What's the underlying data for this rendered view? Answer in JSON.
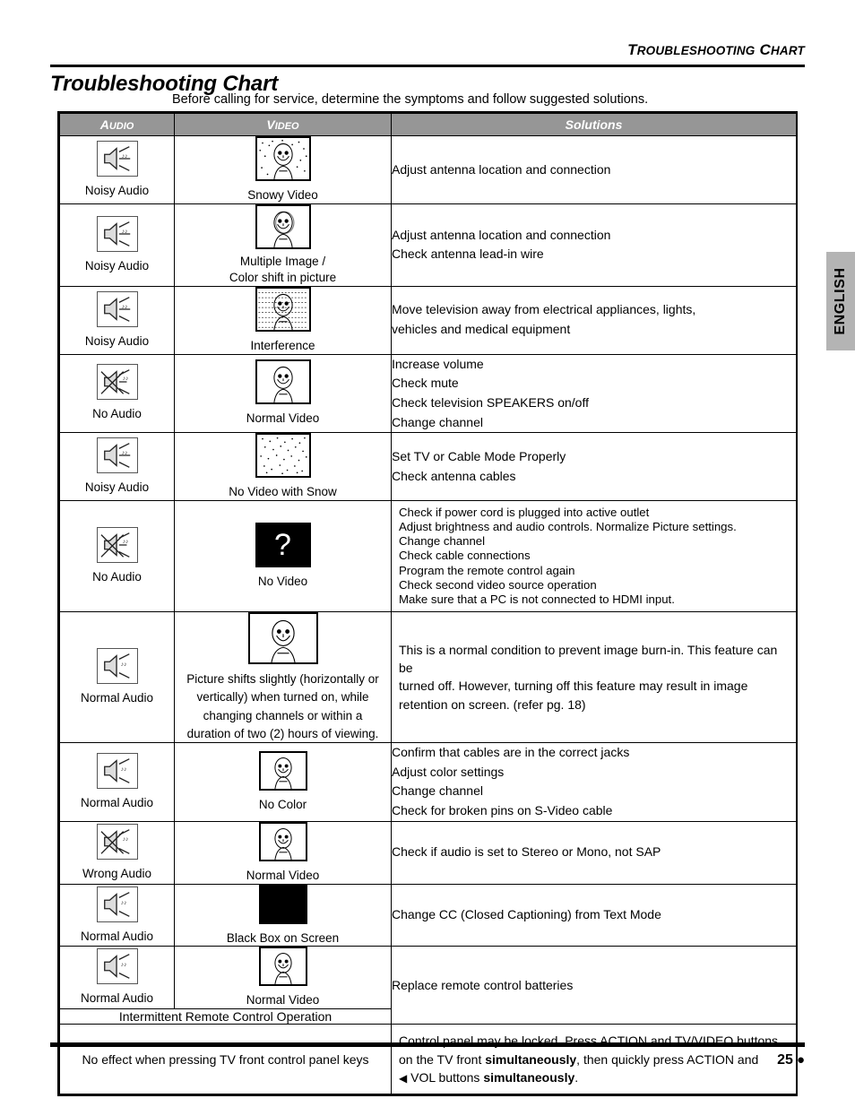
{
  "running_head": {
    "word1_cap": "T",
    "word1_rest": "ROUBLESHOOTING",
    "word2_cap": "C",
    "word2_rest": "HART"
  },
  "title": "Troubleshooting Chart",
  "subtitle": "Before calling for service, determine the symptoms and follow suggested solutions.",
  "language_tab": "ENGLISH",
  "footer": {
    "page_number": "25",
    "dot": "●"
  },
  "table": {
    "headers": {
      "audio_cap": "A",
      "audio_rest": "UDIO",
      "video_cap": "V",
      "video_rest": "IDEO",
      "solutions": "Solutions"
    },
    "rows": [
      {
        "audio_icon": "speaker-noisy-icon",
        "audio_label": "Noisy Audio",
        "video_icon": "tv-snowy-icon",
        "video_label": "Snowy Video",
        "solutions": [
          "Adjust antenna location and connection"
        ]
      },
      {
        "audio_icon": "speaker-noisy-icon",
        "audio_label": "Noisy Audio",
        "video_icon": "tv-multiple-image-icon",
        "video_label": "Multiple Image /\nColor shift in picture",
        "video_label_line1": "Multiple Image /",
        "video_label_line2": "Color shift in picture",
        "solutions": [
          "Adjust antenna location and connection",
          "Check antenna lead-in wire"
        ]
      },
      {
        "audio_icon": "speaker-noisy-icon",
        "audio_label": "Noisy Audio",
        "video_icon": "tv-interference-icon",
        "video_label": "Interference",
        "solutions": [
          "Move television away from electrical appliances, lights,",
          "vehicles and medical equipment"
        ]
      },
      {
        "audio_icon": "speaker-muted-icon",
        "audio_label": "No Audio",
        "video_icon": "tv-normal-icon",
        "video_label": "Normal Video",
        "solutions": [
          "Increase volume",
          "Check mute",
          "Check television SPEAKERS on/off",
          "Change channel"
        ]
      },
      {
        "audio_icon": "speaker-noisy-icon",
        "audio_label": "Noisy Audio",
        "video_icon": "tv-snow-only-icon",
        "video_label": "No Video with Snow",
        "solutions": [
          "Set TV or Cable Mode Properly",
          "Check antenna cables"
        ]
      },
      {
        "audio_icon": "speaker-muted-icon",
        "audio_label": "No Audio",
        "video_icon": "tv-no-video-icon",
        "video_label": "No Video",
        "solutions": [
          "Check if power cord is plugged into active outlet",
          "Adjust brightness and audio controls. Normalize Picture settings.",
          "Change channel",
          "Check cable connections",
          "Program the remote control again",
          "Check second video source operation",
          "Make sure that a PC is not connected to HDMI input."
        ]
      },
      {
        "audio_icon": "speaker-normal-icon",
        "audio_label": "Normal Audio",
        "video_icon": "tv-normal-large-icon",
        "video_desc_lines": [
          "Picture shifts slightly (horizontally or",
          "vertically) when turned on, while",
          "changing channels or within a",
          "duration of two (2) hours of viewing."
        ],
        "solutions": [
          "This is a normal condition to prevent image burn-in. This feature can be",
          "turned off. However, turning off this feature may result in image",
          "retention on screen. (refer pg. 18)"
        ]
      },
      {
        "audio_icon": "speaker-normal-icon",
        "audio_label": "Normal Audio",
        "video_icon": "tv-no-color-icon",
        "video_label": "No Color",
        "solutions": [
          "Confirm that cables are in the correct jacks",
          "Adjust color settings",
          "Change channel",
          "Check for broken pins on S-Video cable"
        ]
      },
      {
        "audio_icon": "speaker-wrong-icon",
        "audio_label": "Wrong Audio",
        "video_icon": "tv-normal-icon",
        "video_label": "Normal Video",
        "solutions": [
          "Check if audio is set to Stereo or Mono, not SAP"
        ]
      },
      {
        "audio_icon": "speaker-normal-icon",
        "audio_label": "Normal Audio",
        "video_icon": "tv-black-box-icon",
        "video_label": "Black Box on Screen",
        "solutions": [
          "Change CC (Closed Captioning) from Text Mode"
        ]
      },
      {
        "audio_icon": "speaker-normal-icon",
        "audio_label": "Normal Audio",
        "video_icon": "tv-normal-icon",
        "video_label": "Normal Video",
        "merged_note": "Intermittent Remote Control Operation",
        "solutions": [
          "Replace remote control batteries"
        ]
      }
    ],
    "last_row": {
      "label": "No effect when pressing TV front control panel keys",
      "solution_line1_a": "Control panel may be locked. Press ACTION and TV/VIDEO buttons",
      "solution_line2_a": "on the TV front ",
      "solution_line2_b": "simultaneously",
      "solution_line2_c": ", then quickly press ACTION and",
      "solution_line3_arrow": "◀",
      "solution_line3_a": " VOL buttons ",
      "solution_line3_b": "simultaneously",
      "solution_line3_c": "."
    }
  },
  "colors": {
    "header_gray": "#969696",
    "tab_gray": "#b4b4b4",
    "rule_black": "#000000"
  }
}
